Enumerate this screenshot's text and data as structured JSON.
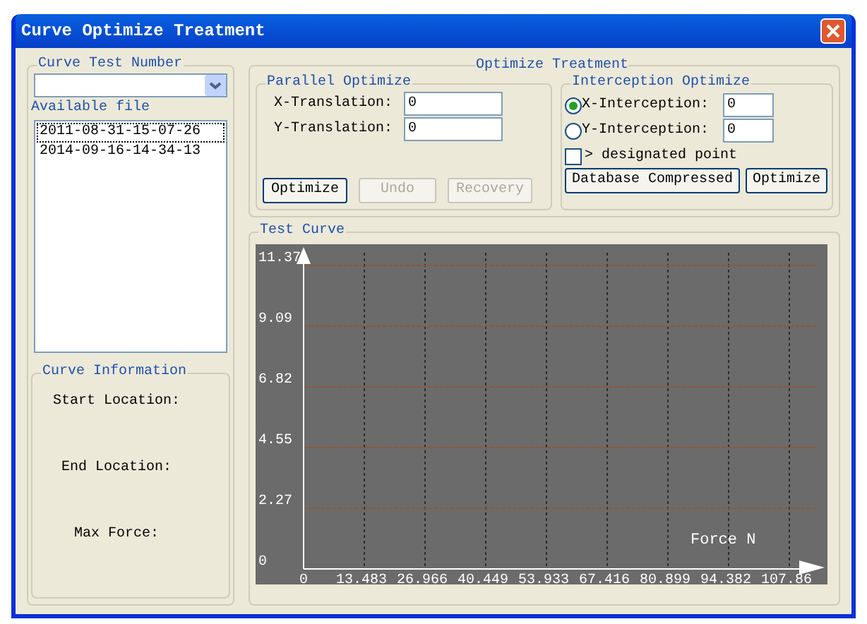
{
  "window": {
    "title": "Curve Optimize Treatment"
  },
  "curve_test_number": {
    "label": "Curve Test Number"
  },
  "available_file": {
    "label": "Available file",
    "items": [
      {
        "label": "2011-08-31-15-07-26",
        "selected": true
      },
      {
        "label": "2014-09-16-14-34-13",
        "selected": false
      }
    ]
  },
  "curve_information": {
    "label": "Curve Information",
    "fields": [
      "Start Location:",
      "End Location:",
      "Max Force:"
    ]
  },
  "optimize_treatment": {
    "label": "Optimize Treatment",
    "parallel_optimize": {
      "label": "Parallel Optimize",
      "fields": [
        {
          "label": "X-Translation:",
          "value": "0"
        },
        {
          "label": "Y-Translation:",
          "value": "0"
        }
      ],
      "buttons": [
        {
          "label": "Optimize",
          "disabled": false
        },
        {
          "label": "Undo",
          "disabled": true
        },
        {
          "label": "Recovery",
          "disabled": true
        }
      ]
    },
    "interception_optimize": {
      "label": "Interception Optimize",
      "options": [
        {
          "label": "X-Interception:",
          "value": "0",
          "selected": true
        },
        {
          "label": "Y-Interception:",
          "value": "0",
          "selected": false
        }
      ],
      "checkbox": {
        "label": "> designated point",
        "checked": false
      },
      "buttons": [
        {
          "label": "Database Compressed",
          "disabled": false
        },
        {
          "label": "Optimize",
          "disabled": false
        }
      ]
    }
  },
  "test_curve": {
    "label": "Test Curve",
    "chart_data": {
      "type": "line",
      "grid": true,
      "xlabel": "Force N",
      "xlim": [
        0,
        107.86
      ],
      "ylim": [
        0,
        11.37
      ],
      "xticks": [
        0,
        13.483,
        26.966,
        40.449,
        53.933,
        67.416,
        80.899,
        94.382,
        {
          "value": 107.86,
          "label": "107.86"
        }
      ],
      "yticks": [
        0,
        2.27,
        4.55,
        6.82,
        9.09,
        11.37
      ]
    }
  }
}
